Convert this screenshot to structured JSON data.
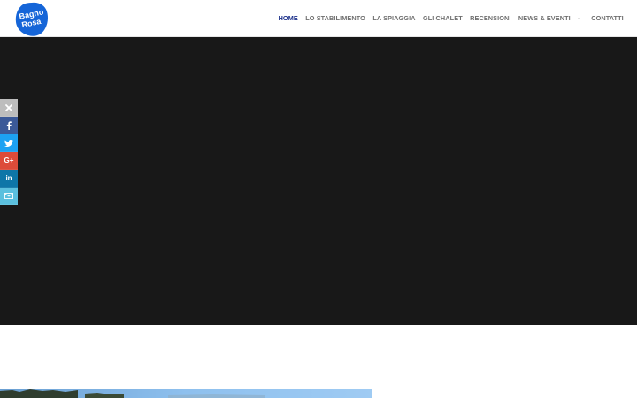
{
  "header": {
    "logo": {
      "text_line1": "Bagno",
      "text_line2": "Rosa",
      "color": "#1565d8"
    },
    "nav": {
      "items": [
        {
          "label": "HOME",
          "active": true
        },
        {
          "label": "LO STABILIMENTO",
          "active": false
        },
        {
          "label": "LA SPIAGGIA",
          "active": false
        },
        {
          "label": "GLI CHALET",
          "active": false
        },
        {
          "label": "RECENSIONI",
          "active": false
        },
        {
          "label": "NEWS & EVENTI",
          "active": false
        },
        {
          "label": "CONTATTI",
          "active": false
        }
      ],
      "dropdown_icon": "chevron-down-icon",
      "active_color": "#1a2f8a",
      "inactive_color": "#6f6f6f"
    }
  },
  "hero": {
    "background_color": "#181818"
  },
  "social_bar": {
    "buttons": [
      {
        "name": "close",
        "icon": "close-icon",
        "color": "#bdbdbd"
      },
      {
        "name": "facebook",
        "icon": "facebook-icon",
        "color": "#3b5998"
      },
      {
        "name": "twitter",
        "icon": "twitter-icon",
        "color": "#1da1f2"
      },
      {
        "name": "google-plus",
        "icon": "google-plus-icon",
        "color": "#dd4b39"
      },
      {
        "name": "linkedin",
        "icon": "linkedin-icon",
        "color": "#0e76a8"
      },
      {
        "name": "email",
        "icon": "envelope-icon",
        "color": "#5bc0de"
      }
    ]
  }
}
